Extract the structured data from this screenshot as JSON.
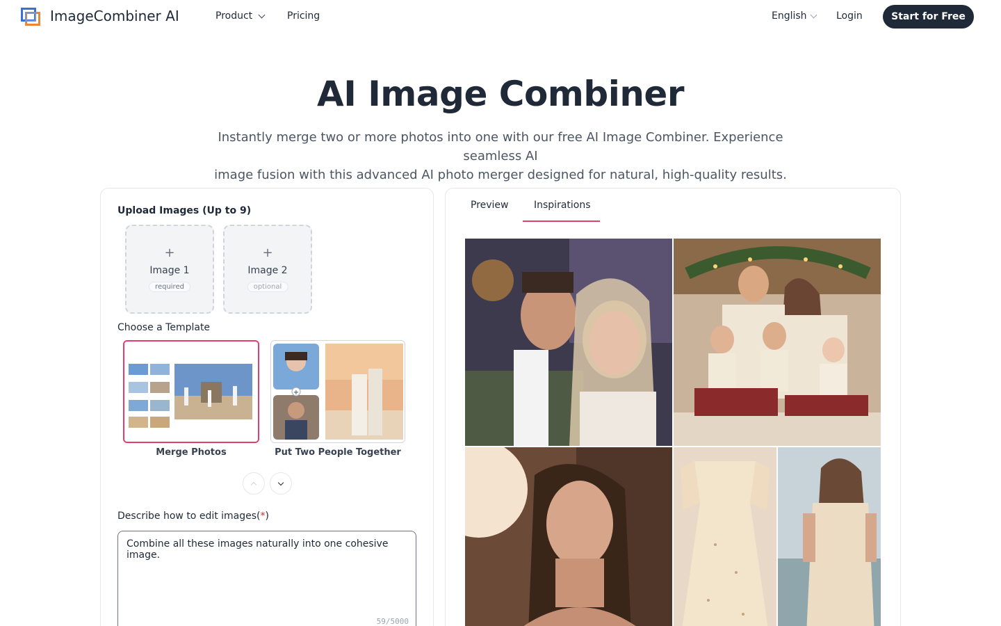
{
  "header": {
    "brand": "ImageCombiner AI",
    "nav": {
      "product": "Product",
      "pricing": "Pricing"
    },
    "language": "English",
    "login": "Login",
    "cta": "Start for Free"
  },
  "hero": {
    "title": "AI Image Combiner",
    "subtitle_line1": "Instantly merge two or more photos into one with our free AI Image Combiner. Experience seamless AI",
    "subtitle_line2": "image fusion with this advanced AI photo merger designed for natural, high-quality results."
  },
  "editor": {
    "upload_label": "Upload Images (Up to 9)",
    "slots": [
      {
        "plus": "+",
        "name": "Image 1",
        "tag": "required"
      },
      {
        "plus": "+",
        "name": "Image 2",
        "tag": "optional"
      }
    ],
    "template_label": "Choose a Template",
    "templates": [
      {
        "label": "Merge Photos",
        "selected": true
      },
      {
        "label": "Put Two People Together",
        "selected": false
      }
    ],
    "describe_label": "Describe how to edit images(",
    "describe_required": "*",
    "describe_close": ")",
    "prompt_value": "Combine all these images naturally into one cohesive image.",
    "counter": "59/5000"
  },
  "preview": {
    "tabs": [
      {
        "label": "Preview"
      },
      {
        "label": "Inspirations",
        "active": true
      }
    ],
    "accent": "#e23e6b"
  }
}
